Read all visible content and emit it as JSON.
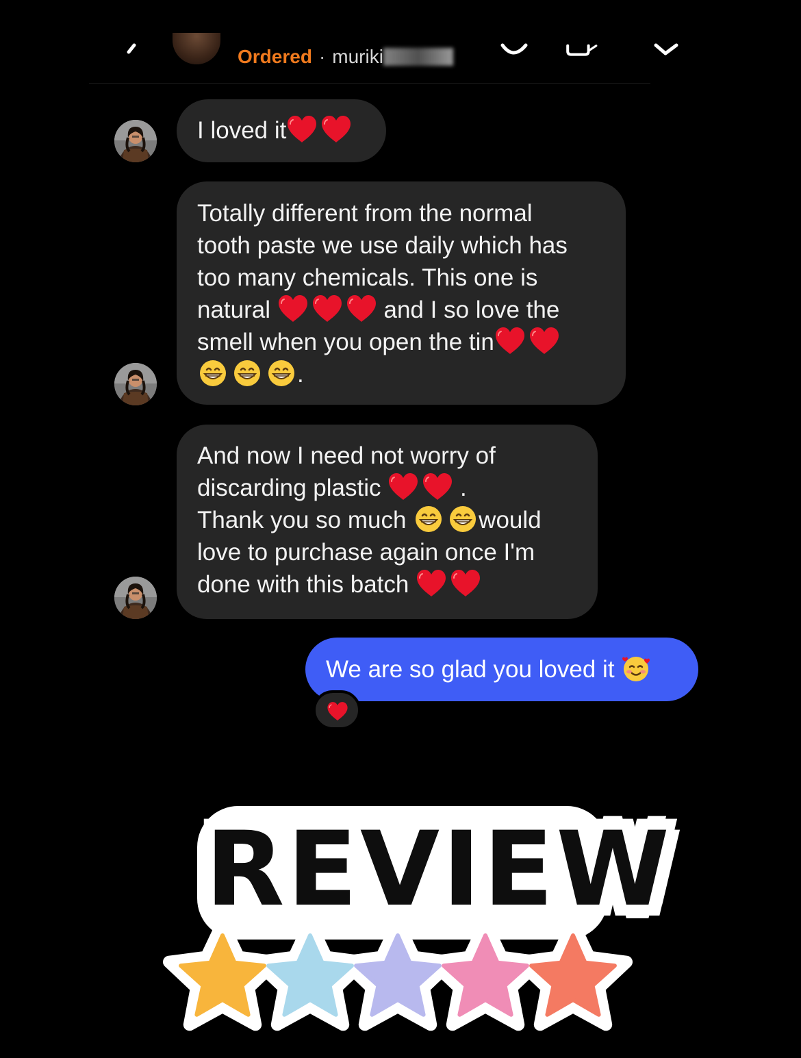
{
  "header": {
    "status_label": "Ordered",
    "separator": "·",
    "handle_visible": "muriki",
    "handle_obscured": true,
    "ordered_color": "#f07a1e"
  },
  "messages": [
    {
      "direction": "received",
      "lines": [
        [
          "I loved it",
          "red-heart",
          "red-heart"
        ]
      ]
    },
    {
      "direction": "received",
      "lines": [
        "Totally different from the normal",
        "tooth paste we use daily which has",
        "too many chemicals. This one is",
        "natural [3 red-heart] and I so love the",
        "smell when you open the tin [2 red-heart]",
        "[3 grinning-face] ."
      ],
      "text": {
        "l1": "Totally different from the normal",
        "l2": "tooth paste we use daily which has",
        "l3": "too many chemicals. This one is",
        "l4a": "natural",
        "l4b": "and I so love the",
        "l5": "smell when you open the tin",
        "l6": "."
      }
    },
    {
      "direction": "received",
      "text": {
        "l1": "And now I need not worry of",
        "l2": "discarding plastic",
        "l2end": ".",
        "l3a": "Thank you so much",
        "l3b": "would",
        "l4": "love to purchase again once I'm",
        "l5": "done with this batch"
      }
    },
    {
      "direction": "sent",
      "text": "We are so glad you loved it",
      "emoji": "smiling-face-with-hearts",
      "reaction": "red-heart",
      "bubble_color": "#3f5df6"
    }
  ],
  "m1": {
    "text": "I loved it"
  },
  "sticker": {
    "title": "REVIEW",
    "rating": 5,
    "max_rating": 5,
    "star_colors": [
      "#f8b53c",
      "#a9d8ec",
      "#b8b9ee",
      "#f08db6",
      "#f47a62"
    ]
  },
  "colors": {
    "background": "#000000",
    "received_bubble": "#262626",
    "sent_bubble": "#3f5df6"
  }
}
